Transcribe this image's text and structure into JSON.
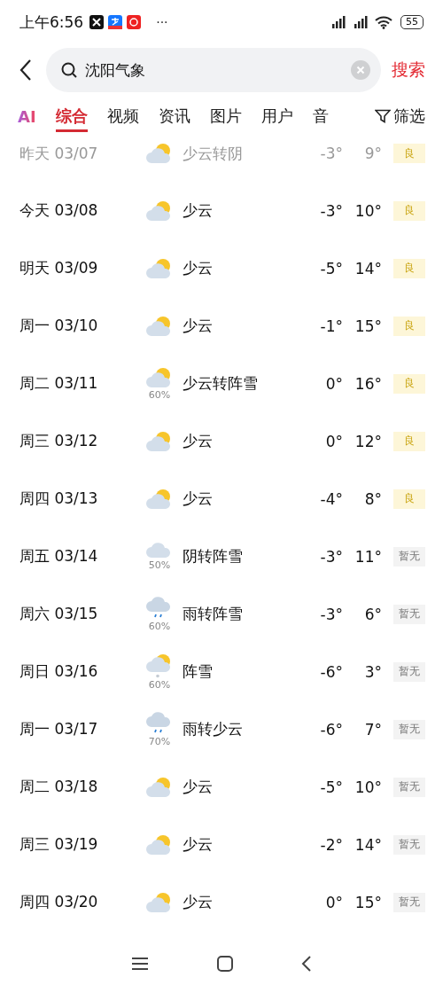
{
  "status_bar": {
    "time": "上午6:56",
    "more": "···",
    "battery": "55"
  },
  "search": {
    "value": "沈阳气象",
    "submit": "搜索"
  },
  "tabs": [
    {
      "label": "AI",
      "kind": "ai",
      "selected": false
    },
    {
      "label": "综合",
      "kind": "text",
      "selected": true
    },
    {
      "label": "视频",
      "kind": "text",
      "selected": false
    },
    {
      "label": "资讯",
      "kind": "text",
      "selected": false
    },
    {
      "label": "图片",
      "kind": "text",
      "selected": false
    },
    {
      "label": "用户",
      "kind": "text",
      "selected": false
    },
    {
      "label": "音",
      "kind": "text",
      "selected": false
    }
  ],
  "filter": {
    "label": "筛选"
  },
  "forecast": [
    {
      "date": "昨天 03/07",
      "kind": "partly-cloudy",
      "desc": "少云转阴",
      "low": "-3°",
      "high": "9°",
      "aqi": {
        "text": "良",
        "kind": "good"
      },
      "past": true
    },
    {
      "date": "今天 03/08",
      "kind": "partly-cloudy",
      "desc": "少云",
      "low": "-3°",
      "high": "10°",
      "aqi": {
        "text": "良",
        "kind": "good"
      },
      "past": false
    },
    {
      "date": "明天 03/09",
      "kind": "partly-cloudy",
      "desc": "少云",
      "low": "-5°",
      "high": "14°",
      "aqi": {
        "text": "良",
        "kind": "good"
      },
      "past": false
    },
    {
      "date": "周一 03/10",
      "kind": "partly-cloudy",
      "desc": "少云",
      "low": "-1°",
      "high": "15°",
      "aqi": {
        "text": "良",
        "kind": "good"
      },
      "past": false
    },
    {
      "date": "周二 03/11",
      "kind": "partly-cloudy",
      "precip": "60%",
      "desc": "少云转阵雪",
      "low": "0°",
      "high": "16°",
      "aqi": {
        "text": "良",
        "kind": "good"
      },
      "past": false
    },
    {
      "date": "周三 03/12",
      "kind": "partly-cloudy",
      "desc": "少云",
      "low": "0°",
      "high": "12°",
      "aqi": {
        "text": "良",
        "kind": "good"
      },
      "past": false
    },
    {
      "date": "周四 03/13",
      "kind": "partly-cloudy",
      "desc": "少云",
      "low": "-4°",
      "high": "8°",
      "aqi": {
        "text": "良",
        "kind": "good"
      },
      "past": false
    },
    {
      "date": "周五 03/14",
      "kind": "cloudy",
      "precip": "50%",
      "desc": "阴转阵雪",
      "low": "-3°",
      "high": "11°",
      "aqi": {
        "text": "暂无",
        "kind": "none"
      },
      "past": false
    },
    {
      "date": "周六 03/15",
      "kind": "rain",
      "precip": "60%",
      "desc": "雨转阵雪",
      "low": "-3°",
      "high": "6°",
      "aqi": {
        "text": "暂无",
        "kind": "none"
      },
      "past": false
    },
    {
      "date": "周日 03/16",
      "kind": "snow-shower",
      "precip": "60%",
      "desc": "阵雪",
      "low": "-6°",
      "high": "3°",
      "aqi": {
        "text": "暂无",
        "kind": "none"
      },
      "past": false
    },
    {
      "date": "周一 03/17",
      "kind": "rain",
      "precip": "70%",
      "desc": "雨转少云",
      "low": "-6°",
      "high": "7°",
      "aqi": {
        "text": "暂无",
        "kind": "none"
      },
      "past": false
    },
    {
      "date": "周二 03/18",
      "kind": "partly-cloudy",
      "desc": "少云",
      "low": "-5°",
      "high": "10°",
      "aqi": {
        "text": "暂无",
        "kind": "none"
      },
      "past": false
    },
    {
      "date": "周三 03/19",
      "kind": "partly-cloudy",
      "desc": "少云",
      "low": "-2°",
      "high": "14°",
      "aqi": {
        "text": "暂无",
        "kind": "none"
      },
      "past": false
    },
    {
      "date": "周四 03/20",
      "kind": "partly-cloudy",
      "desc": "少云",
      "low": "0°",
      "high": "15°",
      "aqi": {
        "text": "暂无",
        "kind": "none"
      },
      "past": false
    }
  ]
}
